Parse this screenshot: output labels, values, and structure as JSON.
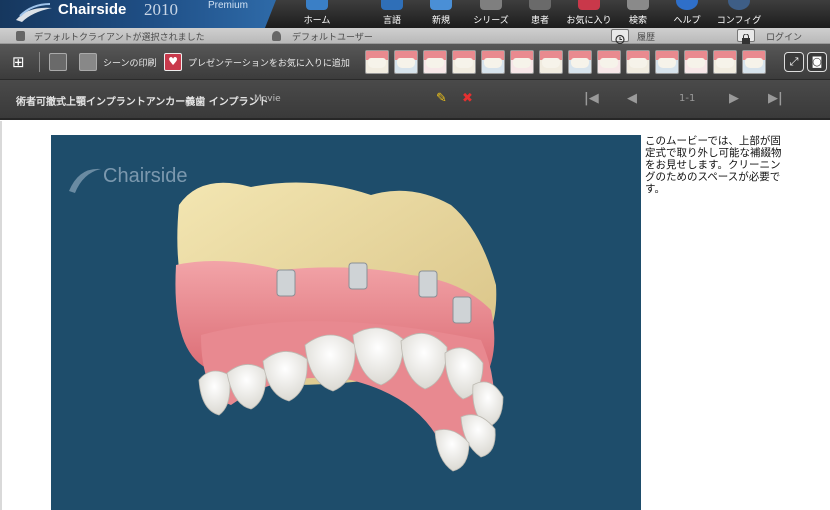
{
  "app": {
    "brand": "Chairside",
    "year": "2010",
    "edition": "Premium"
  },
  "menu": [
    {
      "label": "ホーム",
      "icon": "home-icon",
      "color": "#3a7fc6"
    },
    {
      "label": "言語",
      "icon": "language-icon",
      "color": "#2f6fb8"
    },
    {
      "label": "新規",
      "icon": "new-icon",
      "color": "#4a8fd6"
    },
    {
      "label": "シリーズ",
      "icon": "series-icon",
      "color": "#7f7f7f"
    },
    {
      "label": "患者",
      "icon": "patient-icon",
      "color": "#6a6a6a"
    },
    {
      "label": "お気に入り",
      "icon": "favorites-icon",
      "color": "#c9384a"
    },
    {
      "label": "検索",
      "icon": "search-icon",
      "color": "#8a8a8a"
    },
    {
      "label": "ヘルプ",
      "icon": "help-icon",
      "color": "#2f6fc9"
    },
    {
      "label": "コンフィグ",
      "icon": "config-icon",
      "color": "#3e5e86"
    }
  ],
  "status": {
    "client": "デフォルトクライアントが選択されました",
    "user": "デフォルトユーザー",
    "history": "履歴",
    "login": "ログイン"
  },
  "toolbar": {
    "print_label": "シーンの印刷",
    "favorite_label": "プレゼンテーションをお気に入りに追加",
    "thumbnail_count": 14
  },
  "movie": {
    "title": "術者可撤式上顎インプラントアンカー義歯  インプラント",
    "type": "Movie",
    "page": "1-1",
    "watermark": "Chairside",
    "description": "このムービーでは、上部が固定式で取り外し可能な補綴物をお見せします。クリーニングのためのスペースが必要です。"
  },
  "colors": {
    "menubar": "#2b2b2b",
    "logo_blue": "#1f4f86",
    "video_bg": "#1e4d6b",
    "gum_pink": "#e98a8f",
    "palate_yellow": "#ead9a2"
  }
}
